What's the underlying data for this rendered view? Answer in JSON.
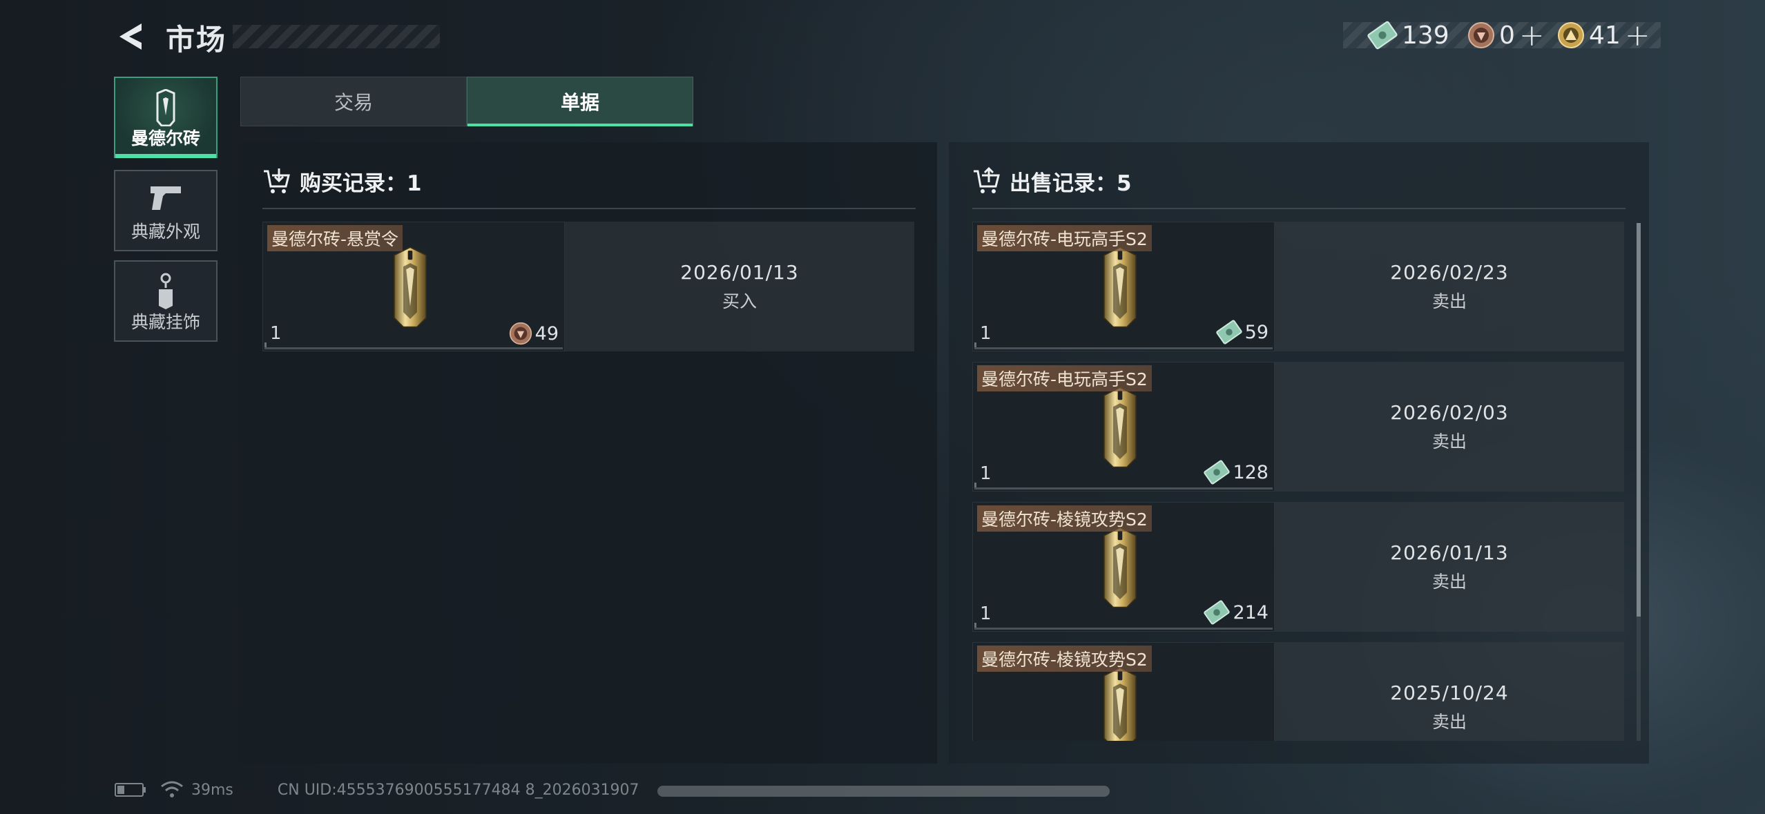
{
  "header": {
    "title": "市场",
    "currencies": [
      {
        "icon": "cash-note-icon",
        "value": "139",
        "plus": ""
      },
      {
        "icon": "bronze-coin-icon",
        "value": "0",
        "plus": "+"
      },
      {
        "icon": "gold-coin-icon",
        "value": "41",
        "plus": "+"
      }
    ]
  },
  "sidebar": {
    "items": [
      {
        "label": "曼德尔砖",
        "icon": "mandel-brick-icon",
        "active": true
      },
      {
        "label": "典藏外观",
        "icon": "pistol-icon",
        "active": false
      },
      {
        "label": "典藏挂饰",
        "icon": "keychain-icon",
        "active": false
      }
    ]
  },
  "tabs": [
    {
      "label": "交易",
      "active": false
    },
    {
      "label": "单据",
      "active": true
    }
  ],
  "purchase": {
    "heading": "购买记录：1",
    "records": [
      {
        "name": "曼德尔砖-悬赏令",
        "qty": "1",
        "price": "49",
        "currency_icon": "bronze-coin-icon",
        "date": "2026/01/13",
        "action": "买入"
      }
    ]
  },
  "sales": {
    "heading": "出售记录：5",
    "records": [
      {
        "name": "曼德尔砖-电玩高手S2",
        "qty": "1",
        "price": "59",
        "currency_icon": "cash-note-icon",
        "date": "2026/02/23",
        "action": "卖出"
      },
      {
        "name": "曼德尔砖-电玩高手S2",
        "qty": "1",
        "price": "128",
        "currency_icon": "cash-note-icon",
        "date": "2026/02/03",
        "action": "卖出"
      },
      {
        "name": "曼德尔砖-棱镜攻势S2",
        "qty": "1",
        "price": "214",
        "currency_icon": "cash-note-icon",
        "date": "2026/01/13",
        "action": "卖出"
      },
      {
        "name": "曼德尔砖-棱镜攻势S2",
        "qty": "",
        "price": "",
        "currency_icon": "",
        "date": "2025/10/24",
        "action": "卖出"
      }
    ]
  },
  "footer": {
    "ping": "39ms",
    "uid": "CN UID:4555376900555177484 8_2026031907"
  },
  "colors": {
    "accent": "#4fe0a8",
    "name_tag_bg": "#7a5a40"
  }
}
